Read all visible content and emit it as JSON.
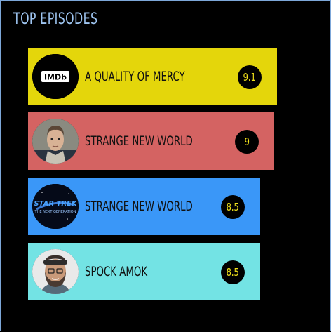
{
  "title": "TOP EPISODES",
  "chart_data": {
    "type": "bar",
    "orientation": "horizontal",
    "title": "TOP EPISODES",
    "categories": [
      "A QUALITY OF MERCY",
      "STRANGE NEW WORLD",
      "STRANGE NEW WORLD",
      "SPOCK AMOK"
    ],
    "values": [
      9.1,
      9,
      8.5,
      8.5
    ],
    "value_labels": [
      "9.1",
      "9",
      "8.5",
      "8.5"
    ],
    "xlim": [
      0,
      9.7
    ],
    "bar_colors": [
      "#e4d60b",
      "#d46362",
      "#3a97f8",
      "#73e3e4"
    ],
    "thumbnails": [
      "imdb-logo-icon",
      "actor-portrait-icon",
      "star-trek-logo-icon",
      "bearded-man-portrait-icon"
    ],
    "grid": false,
    "legend": "none"
  }
}
